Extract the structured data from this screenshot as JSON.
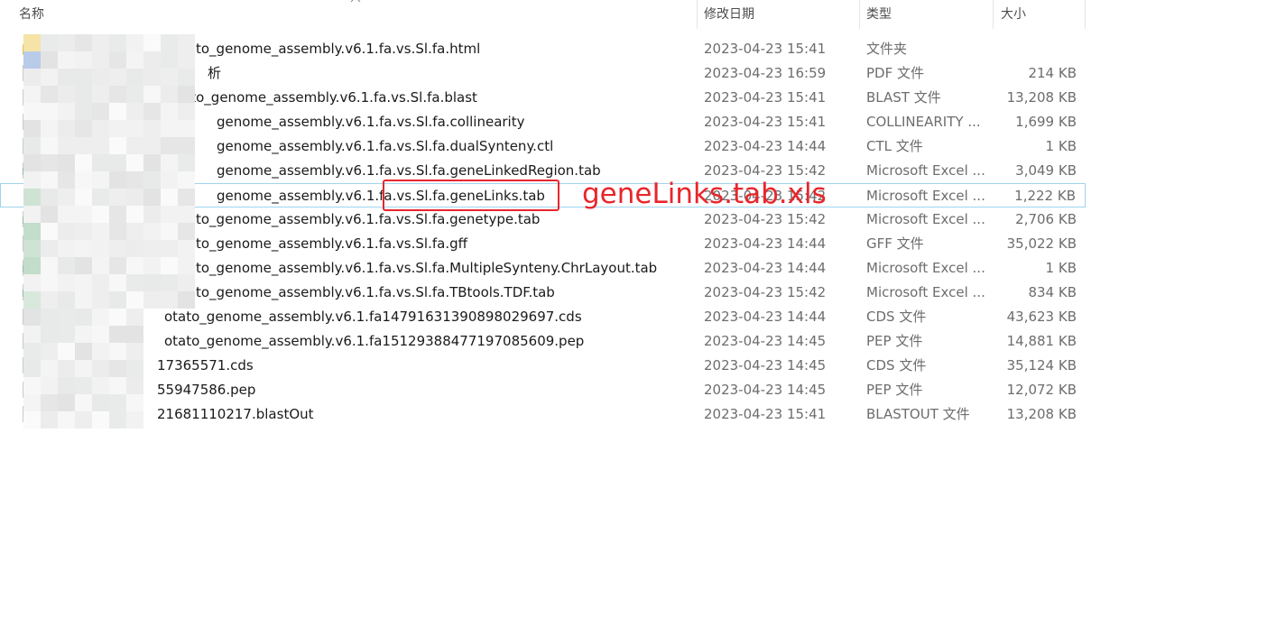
{
  "columns": {
    "name": "名称",
    "date": "修改日期",
    "type": "类型",
    "size": "大小"
  },
  "rows": [
    {
      "name": "to_genome_assembly.v6.1.fa.vs.Sl.fa.html",
      "date": "2023-04-23 15:41",
      "type": "文件夹",
      "size": "",
      "icon": "folder-icon"
    },
    {
      "name": "析",
      "date": "2023-04-23 16:59",
      "type": "PDF 文件",
      "size": "214 KB",
      "icon": "pdf-file-icon"
    },
    {
      "name": "otato_genome_assembly.v6.1.fa.vs.Sl.fa.blast",
      "date": "2023-04-23 15:41",
      "type": "BLAST 文件",
      "size": "13,208 KB",
      "icon": "file-icon"
    },
    {
      "name": "genome_assembly.v6.1.fa.vs.Sl.fa.collinearity",
      "date": "2023-04-23 15:41",
      "type": "COLLINEARITY ...",
      "size": "1,699 KB",
      "icon": "file-icon"
    },
    {
      "name": "genome_assembly.v6.1.fa.vs.Sl.fa.dualSynteny.ctl",
      "date": "2023-04-23 14:44",
      "type": "CTL 文件",
      "size": "1 KB",
      "icon": "file-icon"
    },
    {
      "name": "genome_assembly.v6.1.fa.vs.Sl.fa.geneLinkedRegion.tab",
      "date": "2023-04-23 15:42",
      "type": "Microsoft Excel ...",
      "size": "3,049 KB",
      "icon": "excel-file-icon"
    },
    {
      "name": "genome_assembly.v6.1.fa.vs.Sl.fa.geneLinks.tab",
      "date": "2023-04-23 15:42",
      "type": "Microsoft Excel ...",
      "size": "1,222 KB",
      "icon": "excel-file-icon",
      "selected": true
    },
    {
      "name": "to_genome_assembly.v6.1.fa.vs.Sl.fa.genetype.tab",
      "date": "2023-04-23 15:42",
      "type": "Microsoft Excel ...",
      "size": "2,706 KB",
      "icon": "excel-file-icon"
    },
    {
      "name": "to_genome_assembly.v6.1.fa.vs.Sl.fa.gff",
      "date": "2023-04-23 14:44",
      "type": "GFF 文件",
      "size": "35,022 KB",
      "icon": "file-icon"
    },
    {
      "name": "to_genome_assembly.v6.1.fa.vs.Sl.fa.MultipleSynteny.ChrLayout.tab",
      "date": "2023-04-23 14:44",
      "type": "Microsoft Excel ...",
      "size": "1 KB",
      "icon": "excel-file-icon"
    },
    {
      "name": "to_genome_assembly.v6.1.fa.vs.Sl.fa.TBtools.TDF.tab",
      "date": "2023-04-23 15:42",
      "type": "Microsoft Excel ...",
      "size": "834 KB",
      "icon": "excel-file-icon"
    },
    {
      "name": "otato_genome_assembly.v6.1.fa14791631390898029697.cds",
      "date": "2023-04-23 14:44",
      "type": "CDS 文件",
      "size": "43,623 KB",
      "icon": "file-icon"
    },
    {
      "name": "otato_genome_assembly.v6.1.fa15129388477197085609.pep",
      "date": "2023-04-23 14:45",
      "type": "PEP 文件",
      "size": "14,881 KB",
      "icon": "file-icon"
    },
    {
      "name": "17365571.cds",
      "date": "2023-04-23 14:45",
      "type": "CDS 文件",
      "size": "35,124 KB",
      "icon": "file-icon"
    },
    {
      "name": "55947586.pep",
      "date": "2023-04-23 14:45",
      "type": "PEP 文件",
      "size": "12,072 KB",
      "icon": "file-icon"
    },
    {
      "name": "21681110217.blastOut",
      "date": "2023-04-23 15:41",
      "type": "BLASTOUT 文件",
      "size": "13,208 KB",
      "icon": "file-icon"
    }
  ],
  "annotation": {
    "label": "geneLinks.tab.xls",
    "color": "#e8262b"
  }
}
